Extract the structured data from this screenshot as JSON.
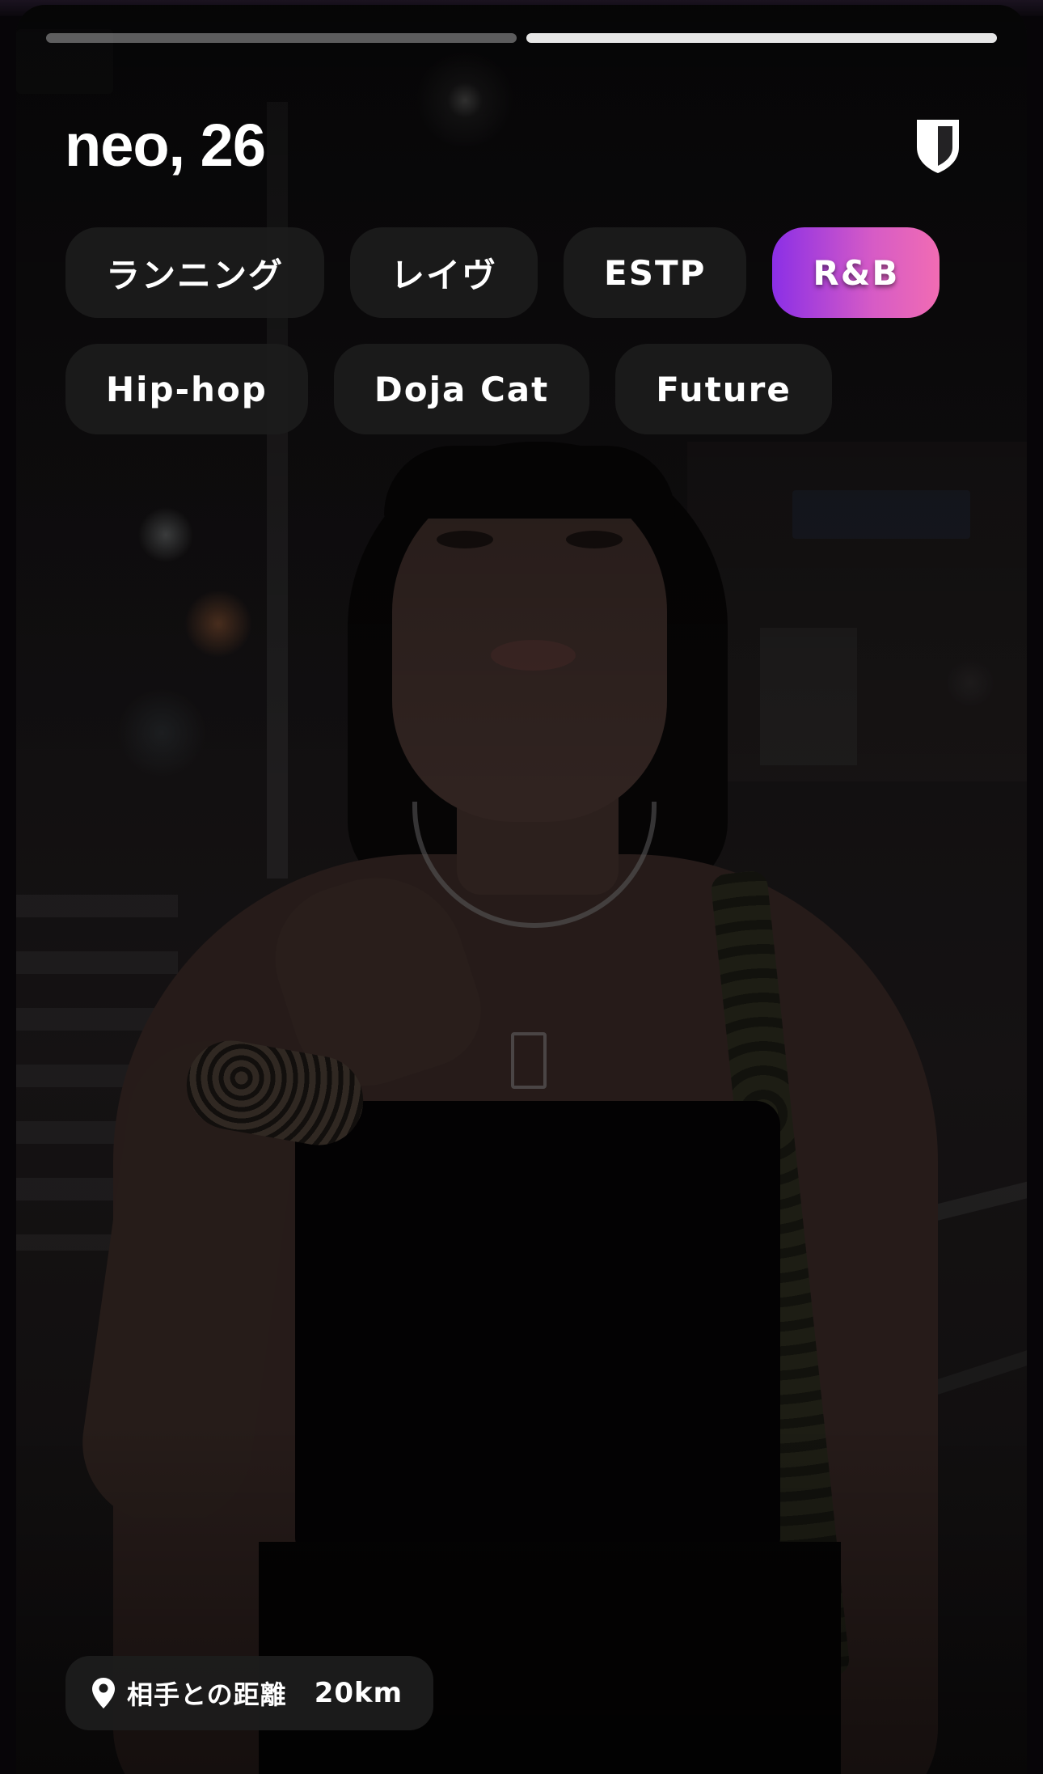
{
  "profile": {
    "name_age": "neo, 26"
  },
  "progress": {
    "total_photos": 2,
    "active_index": 2
  },
  "tags": [
    {
      "label": "ランニング",
      "highlighted": false
    },
    {
      "label": "レイヴ",
      "highlighted": false
    },
    {
      "label": "ESTP",
      "highlighted": false
    },
    {
      "label": "R&B",
      "highlighted": true
    },
    {
      "label": "Hip-hop",
      "highlighted": false
    },
    {
      "label": "Doja Cat",
      "highlighted": false
    },
    {
      "label": "Future",
      "highlighted": false
    }
  ],
  "distance": {
    "label": "相手との距離",
    "value": "20km",
    "icon": "location-pin-icon"
  },
  "header_icon": "shield-icon",
  "colors": {
    "tag_background": "#1c1c1c",
    "highlight_gradient_start": "#8b2fe6",
    "highlight_gradient_end": "#f16cb3",
    "progress_active": "#e6e6e6",
    "progress_inactive": "#5a5a5a"
  }
}
